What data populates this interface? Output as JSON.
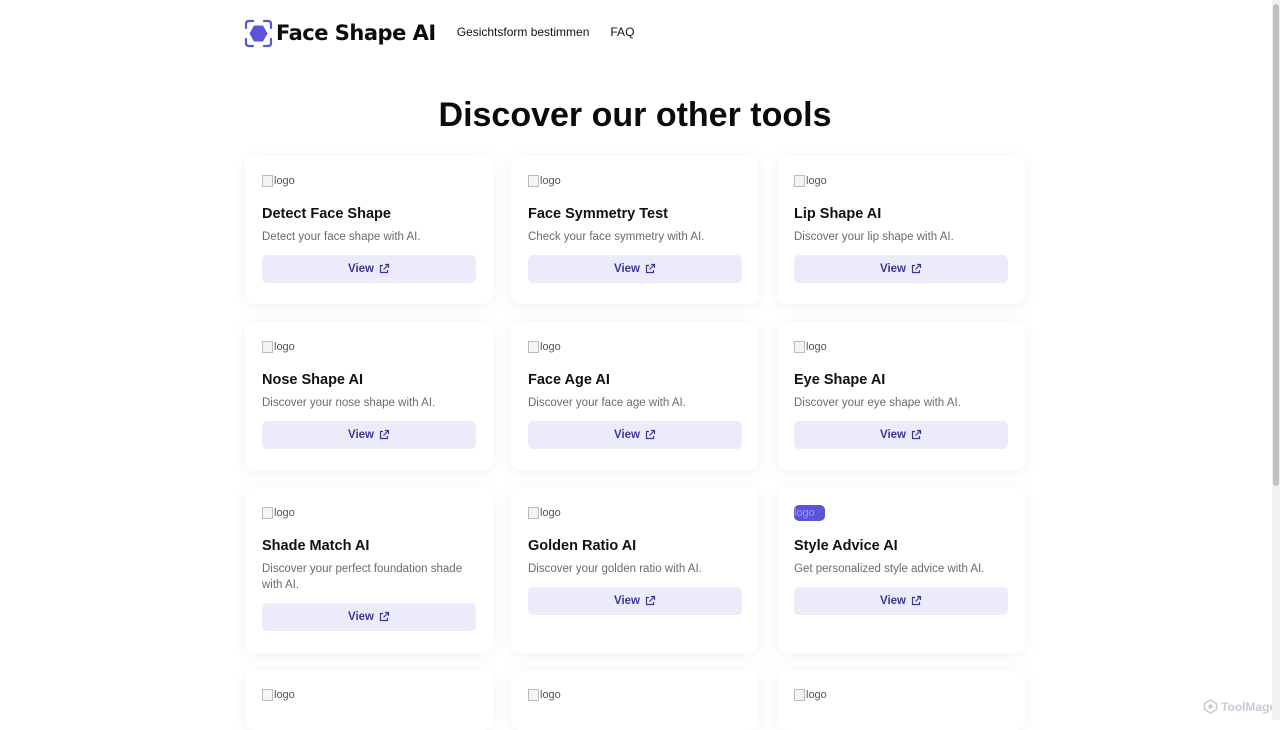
{
  "header": {
    "brand_name": "Face Shape AI",
    "nav": [
      "Gesichtsform bestimmen",
      "FAQ"
    ]
  },
  "page_title": "Discover our other tools",
  "logo_alt": "logo",
  "cards": [
    {
      "title": "Detect Face Shape",
      "desc": "Detect your face shape with AI.",
      "button": "View"
    },
    {
      "title": "Face Symmetry Test",
      "desc": "Check your face symmetry with AI.",
      "button": "View"
    },
    {
      "title": "Lip Shape AI",
      "desc": "Discover your lip shape with AI.",
      "button": "View"
    },
    {
      "title": "Nose Shape AI",
      "desc": "Discover your nose shape with AI.",
      "button": "View"
    },
    {
      "title": "Face Age AI",
      "desc": "Discover your face age with AI.",
      "button": "View"
    },
    {
      "title": "Eye Shape AI",
      "desc": "Discover your eye shape with AI.",
      "button": "View"
    },
    {
      "title": "Shade Match AI",
      "desc": "Discover your perfect foundation shade with AI.",
      "button": "View"
    },
    {
      "title": "Golden Ratio AI",
      "desc": "Discover your golden ratio with AI.",
      "button": "View"
    },
    {
      "title": "Style Advice AI",
      "desc": "Get personalized style advice with AI.",
      "button": "View"
    }
  ],
  "icons": {
    "brand": "face-scan-icon",
    "button": "external-link-icon",
    "watermark": "toolmage-logo-icon"
  },
  "colors": {
    "accent": "#5b54d6",
    "button_bg": "#ecebfa",
    "button_text": "#3e3795"
  },
  "watermark": "ToolMage"
}
